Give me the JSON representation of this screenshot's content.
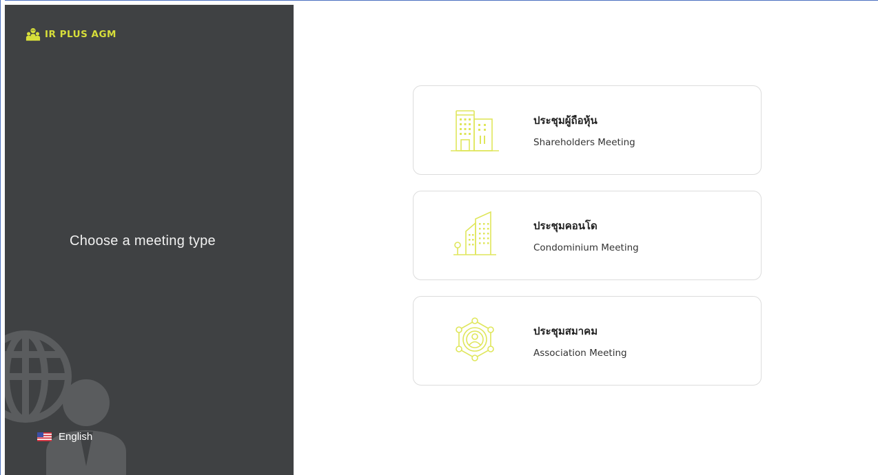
{
  "brand": {
    "name": "IR PLUS AGM",
    "icon": "people-group-icon",
    "color": "#d7de3a"
  },
  "sidebar": {
    "title": "Choose a meeting type",
    "background": "#3f4143",
    "language": {
      "label": "English",
      "icon": "us-flag-icon"
    }
  },
  "meeting_types": [
    {
      "title": "ประชุมผู้ถือหุ้น",
      "subtitle": "Shareholders Meeting",
      "icon": "office-building-icon"
    },
    {
      "title": "ประชุมคอนโด",
      "subtitle": "Condominium Meeting",
      "icon": "condominium-icon"
    },
    {
      "title": "ประชุมสมาคม",
      "subtitle": "Association Meeting",
      "icon": "association-network-icon"
    }
  ],
  "colors": {
    "accent": "#d7de3a",
    "icon_accent": "#dfe65a",
    "card_border": "#dcdcdc"
  }
}
